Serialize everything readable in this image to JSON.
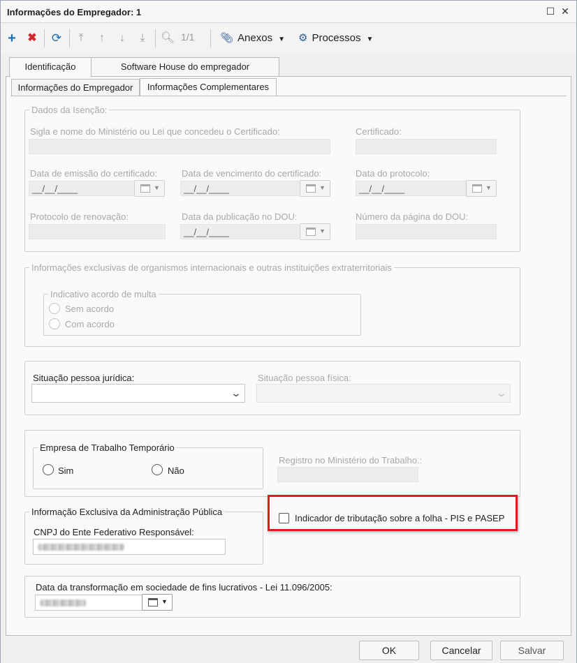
{
  "window": {
    "title": "Informações do Empregador: 1"
  },
  "toolbar": {
    "pager": "1/1",
    "anexos_label": "Anexos",
    "processos_label": "Processos"
  },
  "tabs": {
    "identificacao": "Identificação",
    "software_house": "Software House do empregador",
    "informacoes_empregador": "Informações do Empregador",
    "informacoes_complementares": "Informações Complementares"
  },
  "dados_isencao": {
    "legend": "Dados da Isenção:",
    "sigla_label": "Sigla e nome do Ministério ou Lei que concedeu o Certificado:",
    "certificado_label": "Certificado:",
    "emissao_label": "Data de emissão do certificado:",
    "vencimento_label": "Data de vencimento do certificado:",
    "protocolo_label": "Data do protocolo:",
    "renovacao_label": "Protocolo de renovação:",
    "publicacao_label": "Data da publicação no DOU:",
    "pagina_label": "Número da página do DOU:",
    "date_mask": "__/__/____"
  },
  "organismos": {
    "legend": "Informações exclusivas de organismos internacionais e outras instituições extraterritoriais",
    "multa_legend": "Indicativo acordo de multa",
    "sem_acordo": "Sem acordo",
    "com_acordo": "Com acordo"
  },
  "situacao": {
    "juridica_label": "Situação pessoa jurídica:",
    "fisica_label": "Situação pessoa física:"
  },
  "trabalho_temporario": {
    "legend": "Empresa de Trabalho Temporário",
    "sim": "Sim",
    "nao": "Não",
    "registro_label": "Registro no Ministério do Trabalho.:"
  },
  "administracao_publica": {
    "legend": "Informação Exclusiva da Administração Pública",
    "cnpj_label": "CNPJ do Ente Federativo Responsável:"
  },
  "pis_pasep": {
    "label": "Indicador de tributação sobre a folha - PIS e PASEP",
    "checked": false
  },
  "transformacao": {
    "label": "Data da transformação em sociedade de fins lucrativos - Lei 11.096/2005:"
  },
  "footer": {
    "ok": "OK",
    "cancelar": "Cancelar",
    "salvar": "Salvar"
  },
  "colors": {
    "highlight_border": "#e01b1b",
    "add_icon": "#1f6fb5",
    "delete_icon": "#d0262c"
  }
}
